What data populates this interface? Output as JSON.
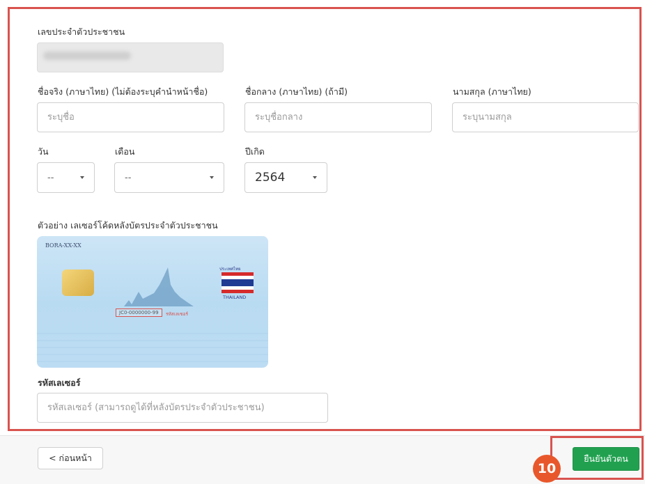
{
  "form": {
    "id_label": "เลขประจำตัวประชาชน",
    "first_name_label": "ชื่อจริง (ภาษาไทย) (ไม่ต้องระบุคำนำหน้าชื่อ)",
    "first_name_placeholder": "ระบุชื่อ",
    "middle_name_label": "ชื่อกลาง (ภาษาไทย) (ถ้ามี)",
    "middle_name_placeholder": "ระบุชื่อกลาง",
    "last_name_label": "นามสกุล (ภาษาไทย)",
    "last_name_placeholder": "ระบุนามสกุล",
    "day_label": "วัน",
    "day_value": "--",
    "month_label": "เดือน",
    "month_value": "--",
    "year_label": "ปีเกิด",
    "year_value": "2564",
    "example_label": "ตัวอย่าง เลเซอร์โค้ดหลังบัตรประจำตัวประชาชน",
    "card": {
      "code": "BORA-XX-XX",
      "country_th": "ประเทศไทย",
      "country_en": "THAILAND",
      "laser_code": "JC0-0000000-99",
      "laser_label": "รหัสเลเซอร์"
    },
    "laser_label": "รหัสเลเซอร์",
    "laser_placeholder": "รหัสเลเซอร์ (สามารถดูได้ที่หลังบัตรประจำตัวประชาชน)"
  },
  "footer": {
    "back_label": "< ก่อนหน้า",
    "confirm_label": "ยืนยันตัวตน",
    "step_number": "10"
  },
  "colors": {
    "highlight": "#d9534f",
    "confirm": "#21a150",
    "badge": "#e8572b"
  }
}
